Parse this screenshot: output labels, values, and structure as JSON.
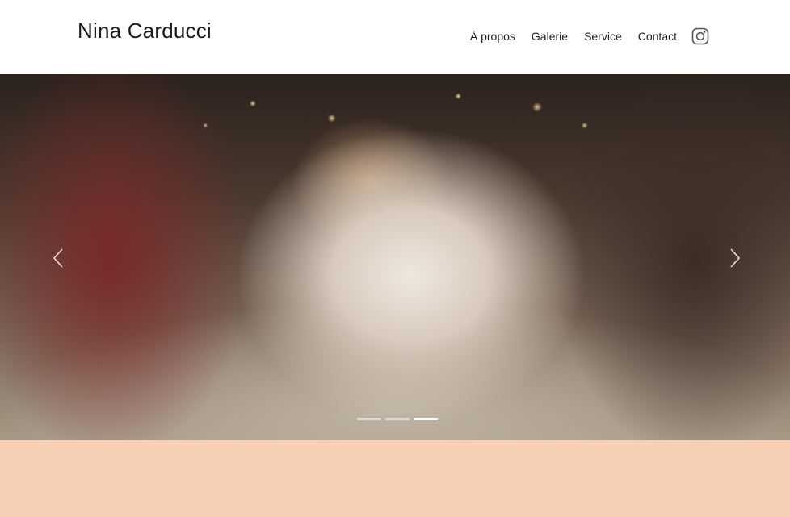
{
  "header": {
    "brand": "Nina Carducci",
    "nav": [
      {
        "label": "À propos"
      },
      {
        "label": "Galerie"
      },
      {
        "label": "Service"
      },
      {
        "label": "Contact"
      }
    ],
    "social_icon": "instagram-icon"
  },
  "carousel": {
    "image_subject": "wedding couple kiss",
    "prev_icon": "chevron-left-icon",
    "next_icon": "chevron-right-icon",
    "slide_count": 3,
    "active_slide": 3
  },
  "colors": {
    "band": "#f6cfb5",
    "text": "#1b1b1b"
  }
}
